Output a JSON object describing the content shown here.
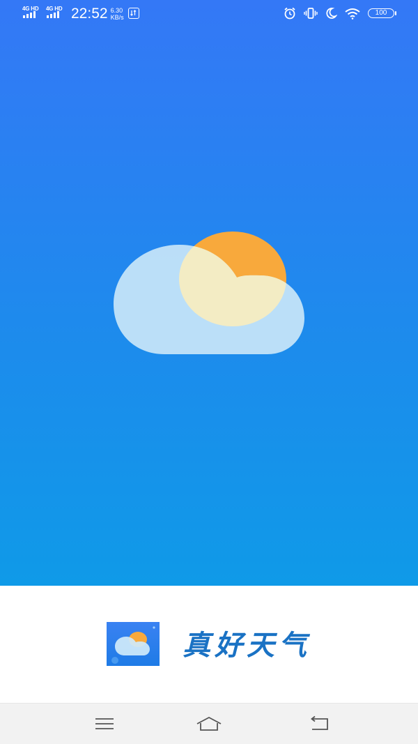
{
  "status_bar": {
    "network_1": "4G HD",
    "network_2": "4G HD",
    "time": "22:52",
    "net_speed_value": "6.30",
    "net_speed_unit": "KB/s",
    "battery_level": "100",
    "icons": [
      "signal-icon",
      "signal-icon",
      "data-usage-icon",
      "alarm-icon",
      "vibrate-icon",
      "moon-icon",
      "wifi-icon",
      "battery-icon"
    ]
  },
  "splash": {
    "logo": "cloud-sun-icon",
    "colors": {
      "gradient_top": "#3478f6",
      "gradient_bottom": "#0f9ae8",
      "sun": "#f8a93c",
      "cloud": "#c9e6f8"
    }
  },
  "brand": {
    "app_name": "真好天气",
    "app_icon": "app-logo-icon",
    "name_color": "#1a72c4"
  },
  "nav_bar": {
    "buttons": [
      "menu-icon",
      "home-icon",
      "back-icon"
    ]
  }
}
